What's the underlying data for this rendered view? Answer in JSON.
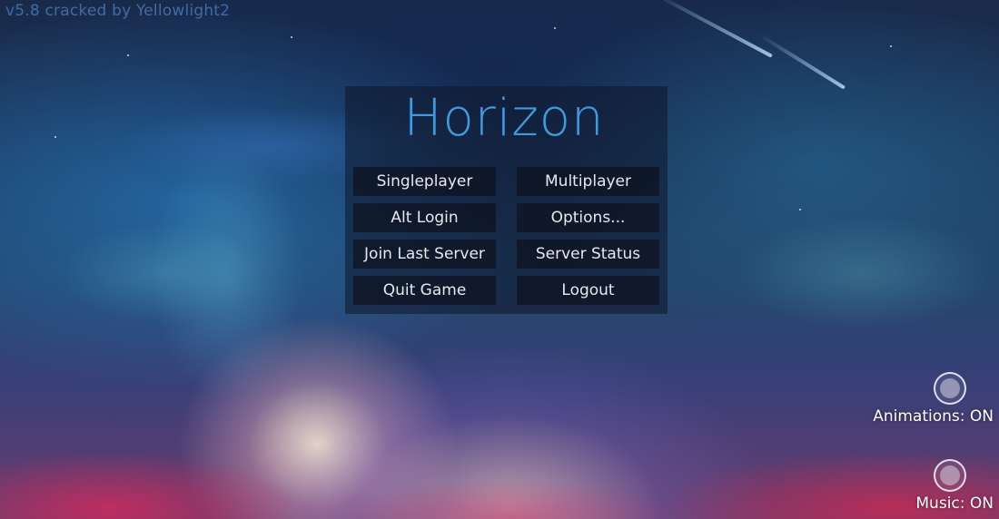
{
  "version_label": "v5.8 cracked by Yellowlight2",
  "title": "Horizon",
  "menu": {
    "buttons": [
      {
        "label": "Singleplayer"
      },
      {
        "label": "Multiplayer"
      },
      {
        "label": "Alt Login"
      },
      {
        "label": "Options..."
      },
      {
        "label": "Join Last Server"
      },
      {
        "label": "Server Status"
      },
      {
        "label": "Quit Game"
      },
      {
        "label": "Logout"
      }
    ]
  },
  "toggles": {
    "animations": {
      "label": "Animations: ON",
      "state": "ON",
      "icon": "toggle-circle-icon"
    },
    "music": {
      "label": "Music: ON",
      "state": "ON",
      "icon": "toggle-circle-icon"
    }
  },
  "colors": {
    "title": "#3d9be0",
    "version_label": "#4678b4",
    "button_bg": "#0c121e",
    "button_text": "#e6e8ee"
  }
}
